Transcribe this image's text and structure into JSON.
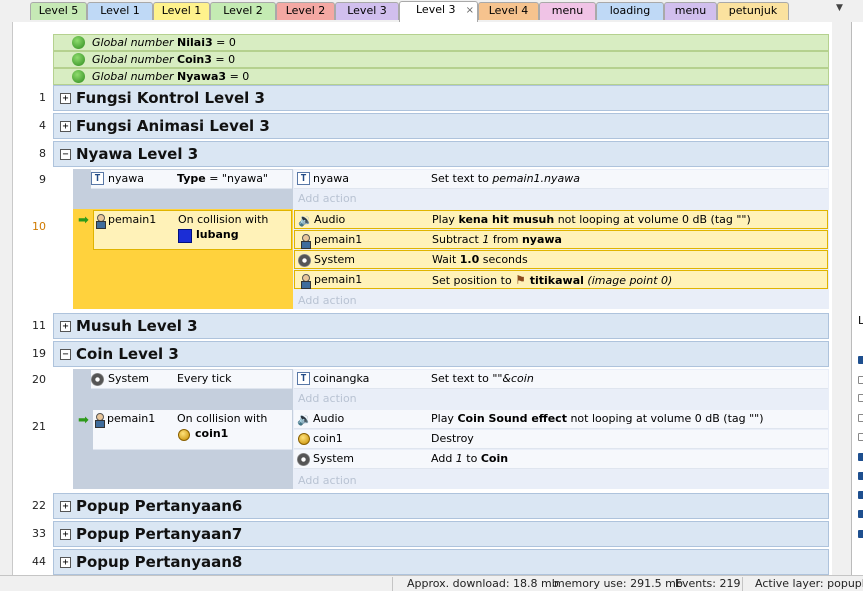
{
  "tabs": [
    {
      "label": "Level 5",
      "color": "#c6e9b5"
    },
    {
      "label": "Level 1",
      "color": "#bfd9f6"
    },
    {
      "label": "Level 1",
      "color": "#fff28c"
    },
    {
      "label": "Level 2",
      "color": "#c4ebb3"
    },
    {
      "label": "Level 2",
      "color": "#f4a8a3"
    },
    {
      "label": "Level 3",
      "color": "#d1bfee"
    },
    {
      "label": "Level 3",
      "color": "#ffffff"
    },
    {
      "label": "Level 4",
      "color": "#f6c38e"
    },
    {
      "label": "menu",
      "color": "#f0c3e6"
    },
    {
      "label": "loading",
      "color": "#bfd9f6"
    },
    {
      "label": "menu",
      "color": "#d1bfee"
    },
    {
      "label": "petunjuk",
      "color": "#fbe29f"
    }
  ],
  "active_tab_close": "×",
  "globals": [
    {
      "kind": "Global number",
      "name": "Nilai3",
      "value": "= 0"
    },
    {
      "kind": "Global number",
      "name": "Coin3",
      "value": "= 0"
    },
    {
      "kind": "Global number",
      "name": "Nyawa3",
      "value": "= 0"
    }
  ],
  "groups": {
    "g1": {
      "line": "1",
      "name": "Fungsi Kontrol Level 3",
      "toggle": "+"
    },
    "g4": {
      "line": "4",
      "name": "Fungsi Animasi  Level 3",
      "toggle": "+"
    },
    "g8": {
      "line": "8",
      "name": "Nyawa Level 3",
      "toggle": "−"
    },
    "g11": {
      "line": "11",
      "name": "Musuh Level 3",
      "toggle": "+"
    },
    "g19": {
      "line": "19",
      "name": "Coin Level 3",
      "toggle": "−"
    },
    "g22": {
      "line": "22",
      "name": "Popup Pertanyaan6",
      "toggle": "+"
    },
    "g33": {
      "line": "33",
      "name": "Popup Pertanyaan7",
      "toggle": "+"
    },
    "g44": {
      "line": "44",
      "name": "Popup Pertanyaan8",
      "toggle": "+"
    }
  },
  "events": {
    "e9": {
      "line": "9",
      "cond_obj": "nyawa",
      "cond_text_pre": "Type",
      "cond_text_post": " = \"nyawa\"",
      "actions": [
        {
          "obj": "nyawa",
          "text_pre": "Set text to ",
          "text_italic": "pemain1.nyawa"
        }
      ]
    },
    "e10": {
      "line": "10",
      "cond_obj": "pemain1",
      "cond_text": "On collision with",
      "cond_target": "lubang",
      "actions": [
        {
          "obj": "Audio",
          "pre": "Play ",
          "bold": "kena hit musuh",
          "post": " not looping at volume 0 dB (tag \"\")"
        },
        {
          "obj": "pemain1",
          "pre": "Subtract ",
          "italic": "1",
          "mid": " from ",
          "bold": "nyawa"
        },
        {
          "obj": "System",
          "pre": "Wait ",
          "bold": "1.0",
          "post": " seconds"
        },
        {
          "obj": "pemain1",
          "pre": "Set position to ",
          "bold": "titikawal",
          "italic": " (image point 0)"
        }
      ]
    },
    "e20": {
      "line": "20",
      "cond_obj": "System",
      "cond_text": "Every tick",
      "actions": [
        {
          "obj": "coinangka",
          "pre": "Set text to ",
          "italic": "\"\"&coin"
        }
      ]
    },
    "e21": {
      "line": "21",
      "cond_obj": "pemain1",
      "cond_text": "On collision with",
      "cond_target": "coin1",
      "actions": [
        {
          "obj": "Audio",
          "pre": "Play ",
          "bold": "Coin Sound effect",
          "post": " not looping at volume 0 dB (tag \"\")"
        },
        {
          "obj": "coin1",
          "pre": "Destroy"
        },
        {
          "obj": "System",
          "pre": "Add ",
          "italic": "1",
          "mid": " to ",
          "bold": "Coin"
        }
      ]
    }
  },
  "add_action_label": "Add action",
  "status": {
    "download": "Approx. download: 18.8 mb",
    "memory": "memory use: 291.5 mb",
    "events": "Events: 219",
    "layer": "Active layer: popuplet"
  },
  "right_panel_letter": "L"
}
